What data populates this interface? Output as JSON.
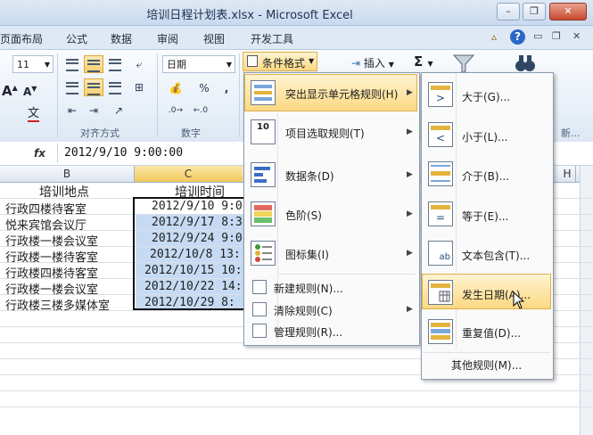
{
  "window": {
    "title": "培训日程计划表.xlsx - Microsoft Excel",
    "minimize": "–",
    "restore": "❐",
    "close": "✕"
  },
  "tabs": [
    "页面布局",
    "公式",
    "数据",
    "审阅",
    "视图",
    "开发工具"
  ],
  "ribbon": {
    "font_size": "11",
    "number_format": "日期",
    "cond_format_label": "条件格式",
    "insert_label": "插入",
    "sigma": "Σ",
    "percent": "%",
    "comma": ",",
    "group_align": "对齐方式",
    "group_number": "数字",
    "group_edit": "新...",
    "font_a_big": "A",
    "font_a_small": "A",
    "wen": "文"
  },
  "formula_bar": {
    "fx": "fx",
    "value": "2012/9/10  9:00:00"
  },
  "sheet": {
    "col_b": "B",
    "col_c": "C",
    "col_h": "H",
    "header_location": "培训地点",
    "header_time": "培训时间",
    "rows": [
      {
        "location": "行政四楼待客室",
        "time": "2012/9/10 9:0"
      },
      {
        "location": "悦来宾馆会议厅",
        "time": "2012/9/17 8:3"
      },
      {
        "location": "行政楼一楼会议室",
        "time": "2012/9/24 9:0"
      },
      {
        "location": "行政楼一楼待客室",
        "time": "2012/10/8 13:"
      },
      {
        "location": "行政楼四楼待客室",
        "time": "2012/10/15 10:"
      },
      {
        "location": "行政楼一楼会议室",
        "time": "2012/10/22 14:"
      },
      {
        "location": "行政楼三楼多媒体室",
        "time": "2012/10/29 8:"
      }
    ]
  },
  "cf_menu": {
    "items": [
      {
        "label": "突出显示单元格规则(H)"
      },
      {
        "label": "项目选取规则(T)",
        "icon_text": "10"
      },
      {
        "label": "数据条(D)"
      },
      {
        "label": "色阶(S)"
      },
      {
        "label": "图标集(I)"
      }
    ],
    "small_items": [
      "新建规则(N)...",
      "清除规则(C)",
      "管理规则(R)..."
    ]
  },
  "sub_menu": {
    "items": [
      {
        "label": "大于(G)..."
      },
      {
        "label": "小于(L)..."
      },
      {
        "label": "介于(B)..."
      },
      {
        "label": "等于(E)..."
      },
      {
        "label": "文本包含(T)...",
        "icon_text": "ab"
      },
      {
        "label": "发生日期(A)..."
      },
      {
        "label": "重复值(D)..."
      }
    ],
    "other": "其他规则(M)..."
  }
}
